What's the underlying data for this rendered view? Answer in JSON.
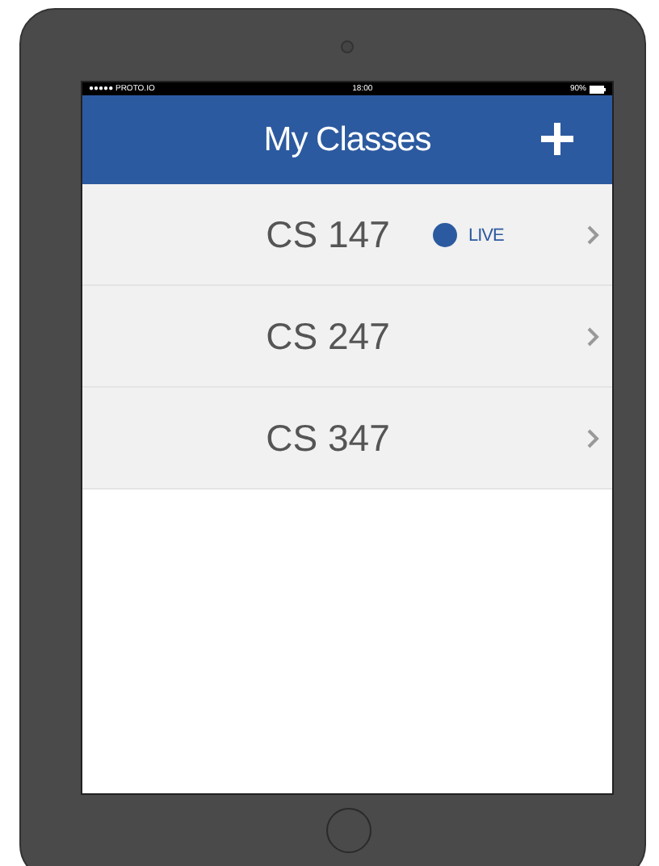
{
  "status_bar": {
    "carrier": "●●●●● PROTO.IO",
    "time": "18:00",
    "battery": "90%"
  },
  "header": {
    "title": "My Classes"
  },
  "classes": [
    {
      "name": "CS 147",
      "live": true,
      "live_label": "LIVE"
    },
    {
      "name": "CS 247",
      "live": false
    },
    {
      "name": "CS 347",
      "live": false
    }
  ]
}
